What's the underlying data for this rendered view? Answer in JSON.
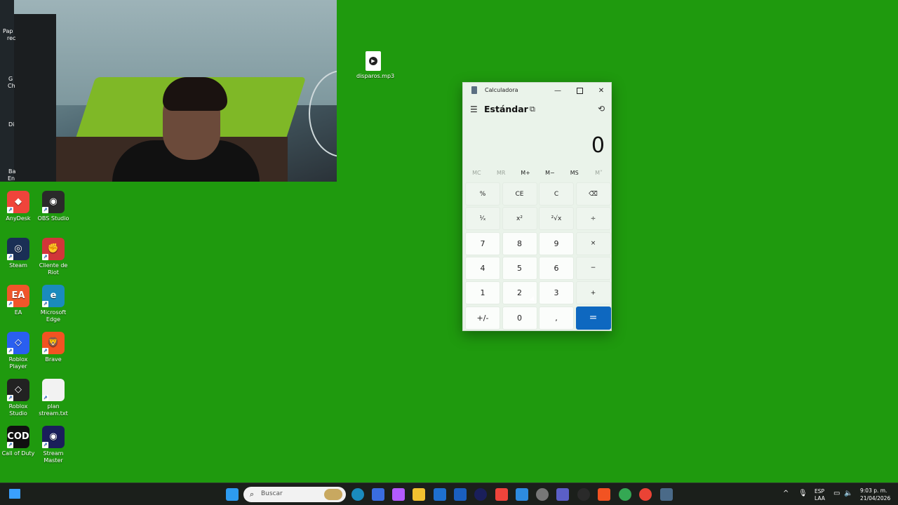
{
  "desktop": {
    "file": {
      "label": "disparos.mp3",
      "icon": "audio-file-icon"
    },
    "partial_labels": [
      "Pap",
      "rec",
      "G",
      "Ch",
      "Di",
      "Ba",
      "En"
    ],
    "icons": [
      {
        "label": "AnyDesk",
        "icon": "anydesk-icon",
        "color": "#ef443b",
        "glyph": "◆"
      },
      {
        "label": "OBS Studio",
        "icon": "obs-icon",
        "color": "#2a2a2a",
        "glyph": "◉"
      },
      {
        "label": "Steam",
        "icon": "steam-icon",
        "color": "#1a2f55",
        "glyph": "◎"
      },
      {
        "label": "Cliente de Riot",
        "icon": "riot-client-icon",
        "color": "#d13639",
        "glyph": "✊"
      },
      {
        "label": "EA",
        "icon": "ea-icon",
        "color": "#f0562a",
        "glyph": "EA"
      },
      {
        "label": "Microsoft Edge",
        "icon": "edge-icon",
        "color": "#1a8bbd",
        "glyph": "e"
      },
      {
        "label": "Roblox Player",
        "icon": "roblox-player-icon",
        "color": "#2a5ff0",
        "glyph": "◇"
      },
      {
        "label": "Brave",
        "icon": "brave-icon",
        "color": "#f25322",
        "glyph": "🦁"
      },
      {
        "label": "Roblox Studio",
        "icon": "roblox-studio-icon",
        "color": "#222222",
        "glyph": "◇"
      },
      {
        "label": "plan stream.txt",
        "icon": "text-file-icon",
        "color": "#f2f2f2",
        "glyph": ""
      },
      {
        "label": "Call of Duty",
        "icon": "call-of-duty-icon",
        "color": "#101010",
        "glyph": "COD"
      },
      {
        "label": "Stream Master",
        "icon": "stream-master-icon",
        "color": "#1a1f5a",
        "glyph": "◉"
      }
    ]
  },
  "calculator": {
    "title": "Calculadora",
    "mode": "Estándar",
    "display": "0",
    "memory": [
      {
        "label": "MC",
        "enabled": false
      },
      {
        "label": "MR",
        "enabled": false
      },
      {
        "label": "M+",
        "enabled": true
      },
      {
        "label": "M−",
        "enabled": true
      },
      {
        "label": "MS",
        "enabled": true
      },
      {
        "label": "M˅",
        "enabled": false
      }
    ],
    "keys": [
      [
        "%",
        "CE",
        "C",
        "⌫"
      ],
      [
        "¹⁄ₓ",
        "x²",
        "²√x",
        "÷"
      ],
      [
        "7",
        "8",
        "9",
        "×"
      ],
      [
        "4",
        "5",
        "6",
        "−"
      ],
      [
        "1",
        "2",
        "3",
        "+"
      ],
      [
        "+/-",
        "0",
        ",",
        "="
      ]
    ],
    "accent": "#0e68c0"
  },
  "taskbar": {
    "search_placeholder": "Buscar",
    "lang_top": "ESP",
    "lang_bottom": "LAA",
    "time": "9:03 p. m.",
    "date": "21/04/2026"
  }
}
